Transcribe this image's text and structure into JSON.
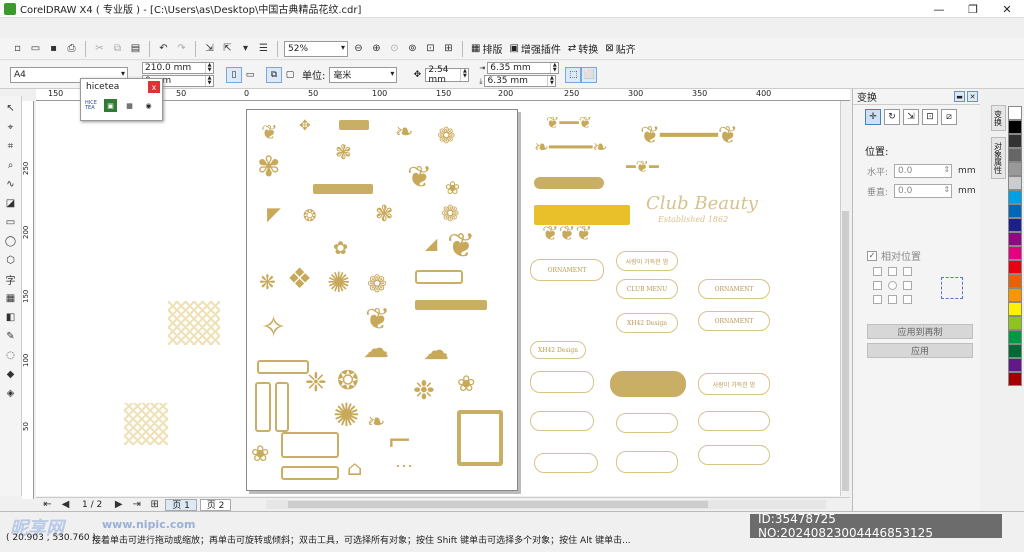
{
  "titlebar": {
    "title": "CorelDRAW X4 ( 专业版 ) - [C:\\Users\\as\\Desktop\\中国古典精品花纹.cdr]",
    "minimize": "—",
    "restore": "❐",
    "close": "✕"
  },
  "toolbar": {
    "zoom": "52%",
    "arrange_label": "排版",
    "plugins_label": "增强插件",
    "convert_label": "转换",
    "snap_label": "贴齐"
  },
  "propbar": {
    "page_size": "A4",
    "width": "210.0 mm",
    "height": "0 mm",
    "units_label": "单位:",
    "units": "毫米",
    "nudge": "2.54 mm",
    "dup_x": "6.35 mm",
    "dup_y": "6.35 mm"
  },
  "ruler": {
    "ticks": [
      "150",
      "100",
      "50",
      "0",
      "50",
      "100",
      "150",
      "200",
      "250",
      "300",
      "350",
      "400"
    ],
    "vticks": [
      "250",
      "200",
      "150",
      "100",
      "50"
    ]
  },
  "hicetea": {
    "title": "hicetea",
    "close": "x",
    "logo": "HICE TEA"
  },
  "canvas": {
    "club_title": "Club Beauty",
    "club_sub": "Established 1862",
    "frame_labels": [
      "ORNAMENT",
      "사랑이 가득한 밤",
      "CLUB MENU",
      "ORNAMENT",
      "XH42 Design",
      "ORNAMENT",
      "XH42 Design",
      "",
      "",
      "",
      "사랑이 가득한 밤",
      ""
    ]
  },
  "pages": {
    "nav_count": "1 / 2",
    "tab1": "页 1",
    "tab2": "页 2"
  },
  "docker": {
    "title": "变换",
    "position_label": "位置:",
    "h_label": "水平:",
    "v_label": "垂直:",
    "h_value": "0.0",
    "v_value": "0.0",
    "unit": "mm",
    "relative_label": "相对位置",
    "apply_copy": "应用到再制",
    "apply": "应用"
  },
  "vtabs": [
    "变换",
    "对象属性"
  ],
  "palette": {
    "colors": [
      "#ffffff",
      "#000000",
      "#333333",
      "#666666",
      "#999999",
      "#cccccc",
      "#00a0e9",
      "#0068b7",
      "#1d2088",
      "#920783",
      "#e4007f",
      "#e60012",
      "#eb6100",
      "#f39800",
      "#fff100",
      "#8fc31f",
      "#009944",
      "#006934",
      "#601986",
      "#a40000"
    ]
  },
  "status": {
    "coords": "( 20.903 , 530.760 )",
    "hint": "接着单击可进行拖动或缩放；再单击可旋转或倾斜；双击工具，可选择所有对象；按住 Shift 键单击可选择多个对象；按住 Alt 键单击...",
    "watermark_id": "ID:35478725 NO:20240823004446853125",
    "brand": "昵享网",
    "brand_url": "www.nipic.com"
  }
}
